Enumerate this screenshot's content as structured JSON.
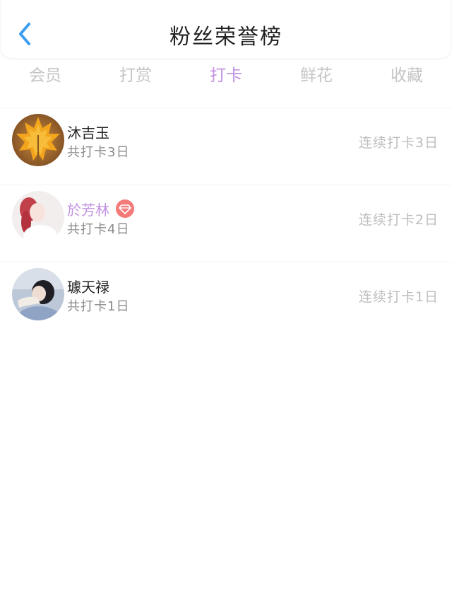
{
  "header": {
    "title": "粉丝荣誉榜",
    "back_icon": "chevron-left-icon",
    "accent_color": "#3a9df0"
  },
  "tabs": [
    {
      "label": "会员",
      "active": false
    },
    {
      "label": "打赏",
      "active": false
    },
    {
      "label": "打卡",
      "active": true
    },
    {
      "label": "鲜花",
      "active": false
    },
    {
      "label": "收藏",
      "active": false
    }
  ],
  "colors": {
    "tab_active": "#c291e2",
    "tab_inactive": "#c4c4c4",
    "badge": "#f47a7a"
  },
  "fans": [
    {
      "name": "沐吉玉",
      "total": "共打卡3日",
      "streak": "连续打卡3日",
      "vip": false,
      "avatar": "maple-leaf-avatar"
    },
    {
      "name": "於芳林",
      "total": "共打卡4日",
      "streak": "连续打卡2日",
      "vip": true,
      "badge_icon": "diamond-icon",
      "avatar": "girl-portrait-avatar"
    },
    {
      "name": "璩天禄",
      "total": "共打卡1日",
      "streak": "连续打卡1日",
      "vip": false,
      "avatar": "girl-photo-avatar"
    }
  ]
}
